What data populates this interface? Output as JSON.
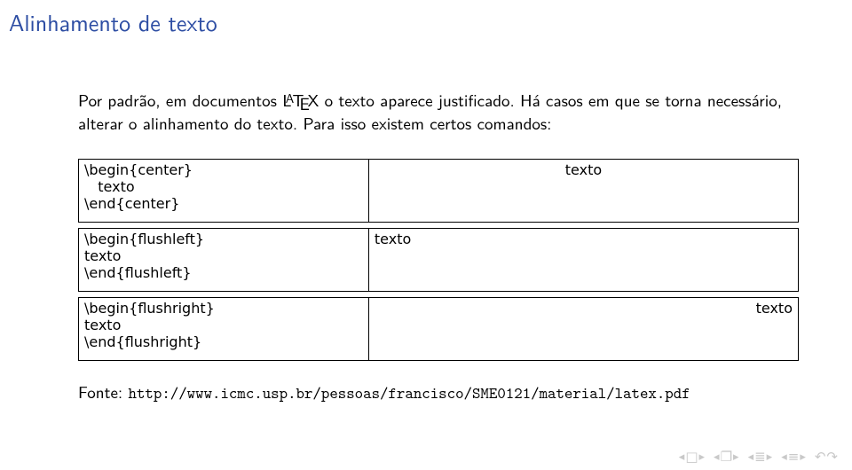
{
  "title": "Alinhamento de texto",
  "paragraph": {
    "p1_a": "Por padrão, em documentos ",
    "p1_b": " o texto aparece justificado. Há casos em que se torna necessário, alterar o alinhamento do texto. Para isso existem certos comandos:"
  },
  "latex_label": "LATEX",
  "examples": [
    {
      "code": "\\begin{center}\n   texto\n\\end{center}",
      "output": "texto",
      "align": "center"
    },
    {
      "code": "\\begin{flushleft}\ntexto\n\\end{flushleft}",
      "output": "texto",
      "align": "left"
    },
    {
      "code": "\\begin{flushright}\ntexto\n\\end{flushright}",
      "output": "texto",
      "align": "right"
    }
  ],
  "source": {
    "label": "Fonte: ",
    "url": "http://www.icmc.usp.br/pessoas/francisco/SME0121/material/latex.pdf"
  },
  "nav_glyphs": {
    "l": "◂",
    "r": "▸",
    "slide": "□",
    "frame": "❐",
    "sub": "≣",
    "sec": "≡",
    "back": "↶",
    "fwd": "↷"
  }
}
